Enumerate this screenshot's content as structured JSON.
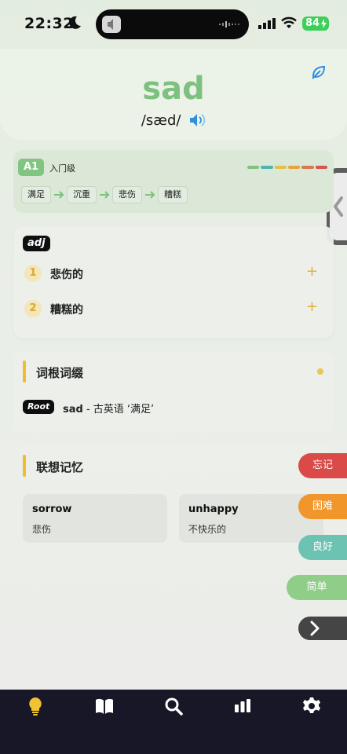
{
  "status": {
    "time": "22:32",
    "battery": "84"
  },
  "word": {
    "headword": "sad",
    "phonetic": "/sæd/"
  },
  "level": {
    "badge": "A1",
    "label": "入门级",
    "bar_colors": [
      "#7fc37f",
      "#4db6ac",
      "#e2c04a",
      "#e8a33d",
      "#d9794d",
      "#d9534f"
    ],
    "chain": [
      "满足",
      "沉重",
      "悲伤",
      "糟糕"
    ]
  },
  "meanings": {
    "pos": "adj",
    "senses": [
      {
        "num": "1",
        "text": "悲伤的"
      },
      {
        "num": "2",
        "text": "糟糕的"
      }
    ]
  },
  "root": {
    "title": "词根词缀",
    "badge": "Root",
    "word": "sad",
    "desc": " - 古英语 ‘满足’"
  },
  "association": {
    "title": "联想记忆",
    "items": [
      {
        "en": "sorrow",
        "cn": "悲伤"
      },
      {
        "en": "unhappy",
        "cn": "不快乐的"
      }
    ]
  },
  "rating": {
    "forget": "忘记",
    "hard": "困难",
    "good": "良好",
    "easy": "简单"
  },
  "colors": {
    "accent_green": "#7dc07f",
    "forget": "#d94a48",
    "hard": "#f0962a",
    "good": "#6cc3b2",
    "easy": "#8fcd88",
    "nav_bg": "#171728",
    "nav_active": "#f1c232"
  },
  "nav": [
    "lightbulb-icon",
    "book-icon",
    "search-icon",
    "stats-icon",
    "settings-icon"
  ]
}
